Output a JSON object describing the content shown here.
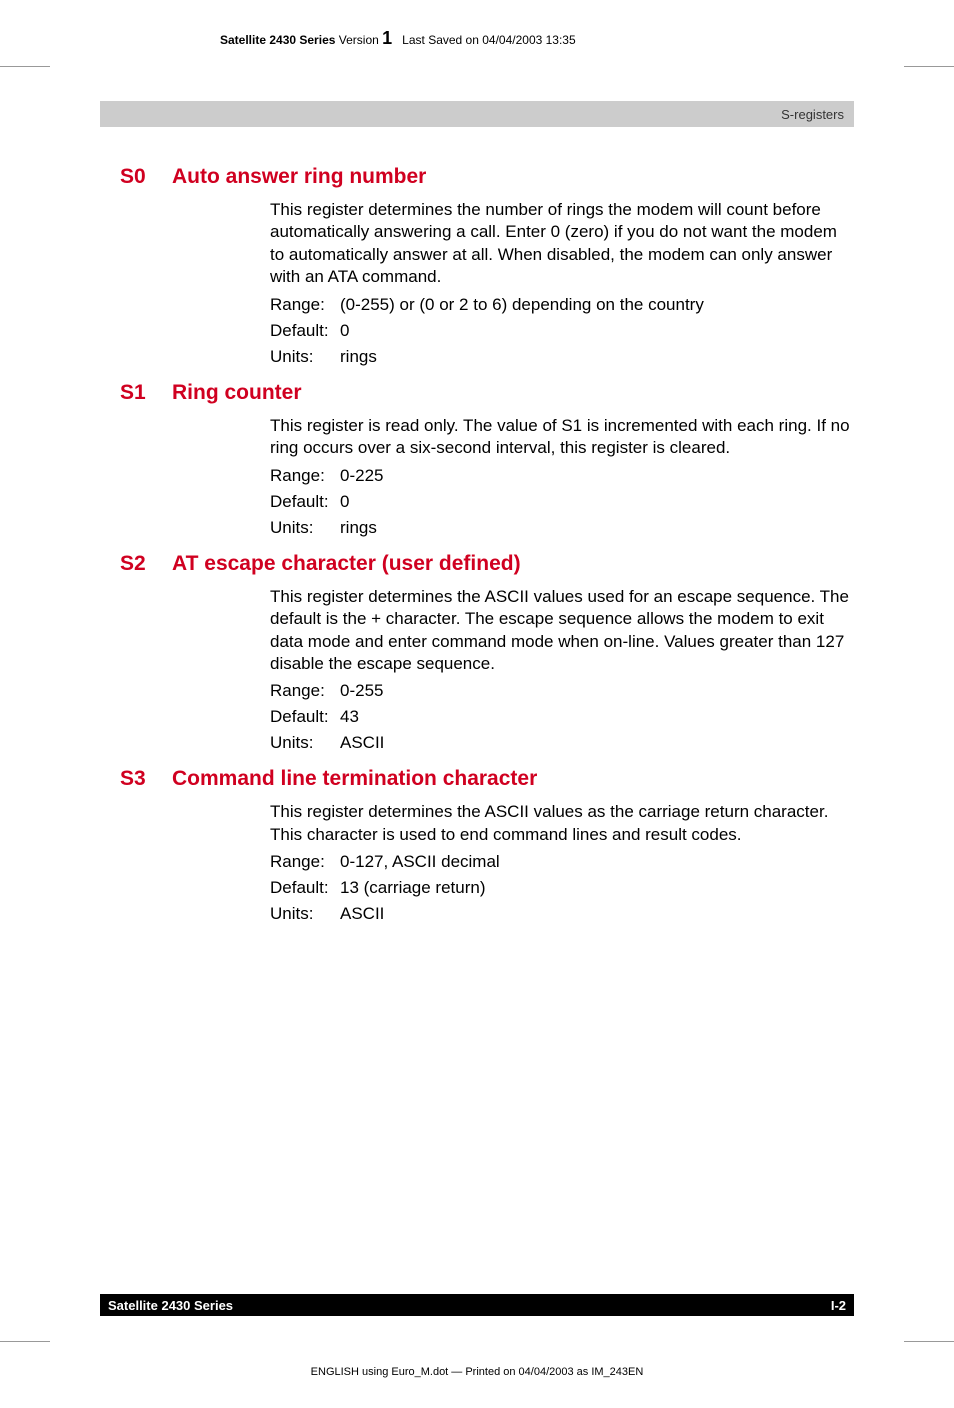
{
  "header": {
    "series_bold": "Satellite 2430 Series",
    "version_label": "Version",
    "version_num": "1",
    "saved": "Last Saved on 04/04/2003 13:35"
  },
  "banner": {
    "right": "S-registers"
  },
  "sections": [
    {
      "reg": "S0",
      "title": "Auto answer ring number",
      "desc": "This register determines the number of rings the modem will count before automatically answering a call. Enter 0 (zero) if you do not want the modem to automatically answer at all. When disabled, the modem can only answer with an ATA command.",
      "range": "(0-255) or (0 or 2 to 6) depending on the country",
      "default": "0",
      "units": "rings"
    },
    {
      "reg": "S1",
      "title": "Ring counter",
      "desc": "This register is read only. The value of S1 is incremented with each ring. If no ring occurs over a six-second interval, this register is cleared.",
      "range": "0-225",
      "default": "0",
      "units": "rings"
    },
    {
      "reg": "S2",
      "title": "AT escape character (user defined)",
      "desc": "This register determines the ASCII values used for an escape sequence. The default is the + character. The escape sequence allows the modem to exit data mode and enter command mode when on-line. Values greater than 127 disable the escape sequence.",
      "range": "0-255",
      "default": "43",
      "units": "ASCII"
    },
    {
      "reg": "S3",
      "title": "Command line termination character",
      "desc": "This register determines the ASCII values as the carriage return character. This character is used to end command lines and result codes.",
      "range": "0-127, ASCII decimal",
      "default": "13 (carriage return)",
      "units": "ASCII"
    }
  ],
  "labels": {
    "range": "Range:",
    "default": "Default:",
    "units": "Units:"
  },
  "footer": {
    "left": "Satellite 2430 Series",
    "right": "I-2"
  },
  "printline": "ENGLISH using  Euro_M.dot — Printed on 04/04/2003 as IM_243EN"
}
